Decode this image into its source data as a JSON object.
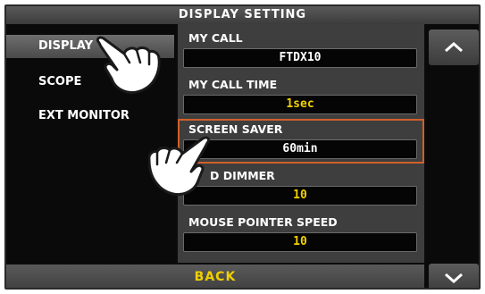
{
  "header": {
    "title": "DISPLAY SETTING"
  },
  "sidebar": {
    "items": [
      {
        "label": "DISPLAY",
        "selected": true
      },
      {
        "label": "SCOPE",
        "selected": false
      },
      {
        "label": "EXT MONITOR",
        "selected": false
      }
    ]
  },
  "settings": [
    {
      "label": "MY CALL",
      "value": "FTDX10",
      "value_color": "#ffffff"
    },
    {
      "label": "MY CALL TIME",
      "value": "1sec",
      "value_color": "#f0d000"
    },
    {
      "label": "SCREEN SAVER",
      "value": "60min",
      "value_color": "#ffffff",
      "highlighted": true
    },
    {
      "label": "D DIMMER",
      "value": "10",
      "value_color": "#f0d000"
    },
    {
      "label": "MOUSE POINTER SPEED",
      "value": "10",
      "value_color": "#f0d000"
    }
  ],
  "footer": {
    "back_label": "BACK"
  },
  "nav": {
    "up_icon": "chevron-up-icon",
    "down_icon": "chevron-down-icon"
  },
  "colors": {
    "accent_yellow": "#f0d000",
    "highlight_border": "#d0602a"
  }
}
